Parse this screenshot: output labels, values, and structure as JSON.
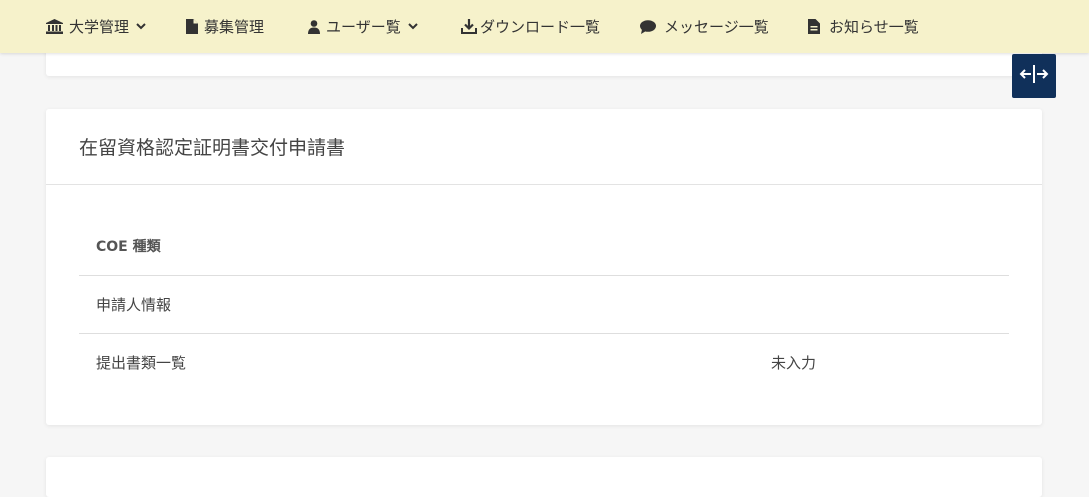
{
  "nav": {
    "items": [
      {
        "label": "大学管理",
        "icon": "university-icon",
        "has_dropdown": true
      },
      {
        "label": "募集管理",
        "icon": "file-icon",
        "has_dropdown": false
      },
      {
        "label": "ユーザー覧",
        "icon": "user-icon",
        "has_dropdown": true
      },
      {
        "label": "ダウンロード一覧",
        "icon": "download-icon",
        "has_dropdown": false
      },
      {
        "label": "メッセージ一覧",
        "icon": "comment-icon",
        "has_dropdown": false
      },
      {
        "label": "お知らせ一覧",
        "icon": "document-icon",
        "has_dropdown": false
      }
    ]
  },
  "sidebar_toggle": {
    "icon": "expand-horizontal-icon"
  },
  "card": {
    "title": "在留資格認定証明書交付申請書",
    "table": {
      "header": "COE 種類",
      "rows": [
        {
          "label": "申請人情報",
          "value": ""
        },
        {
          "label": "提出書類一覧",
          "value": "未入力"
        }
      ]
    }
  },
  "colors": {
    "topbar": "#f6f2cb",
    "toggle": "#10305a",
    "background": "#f6f6f6"
  }
}
